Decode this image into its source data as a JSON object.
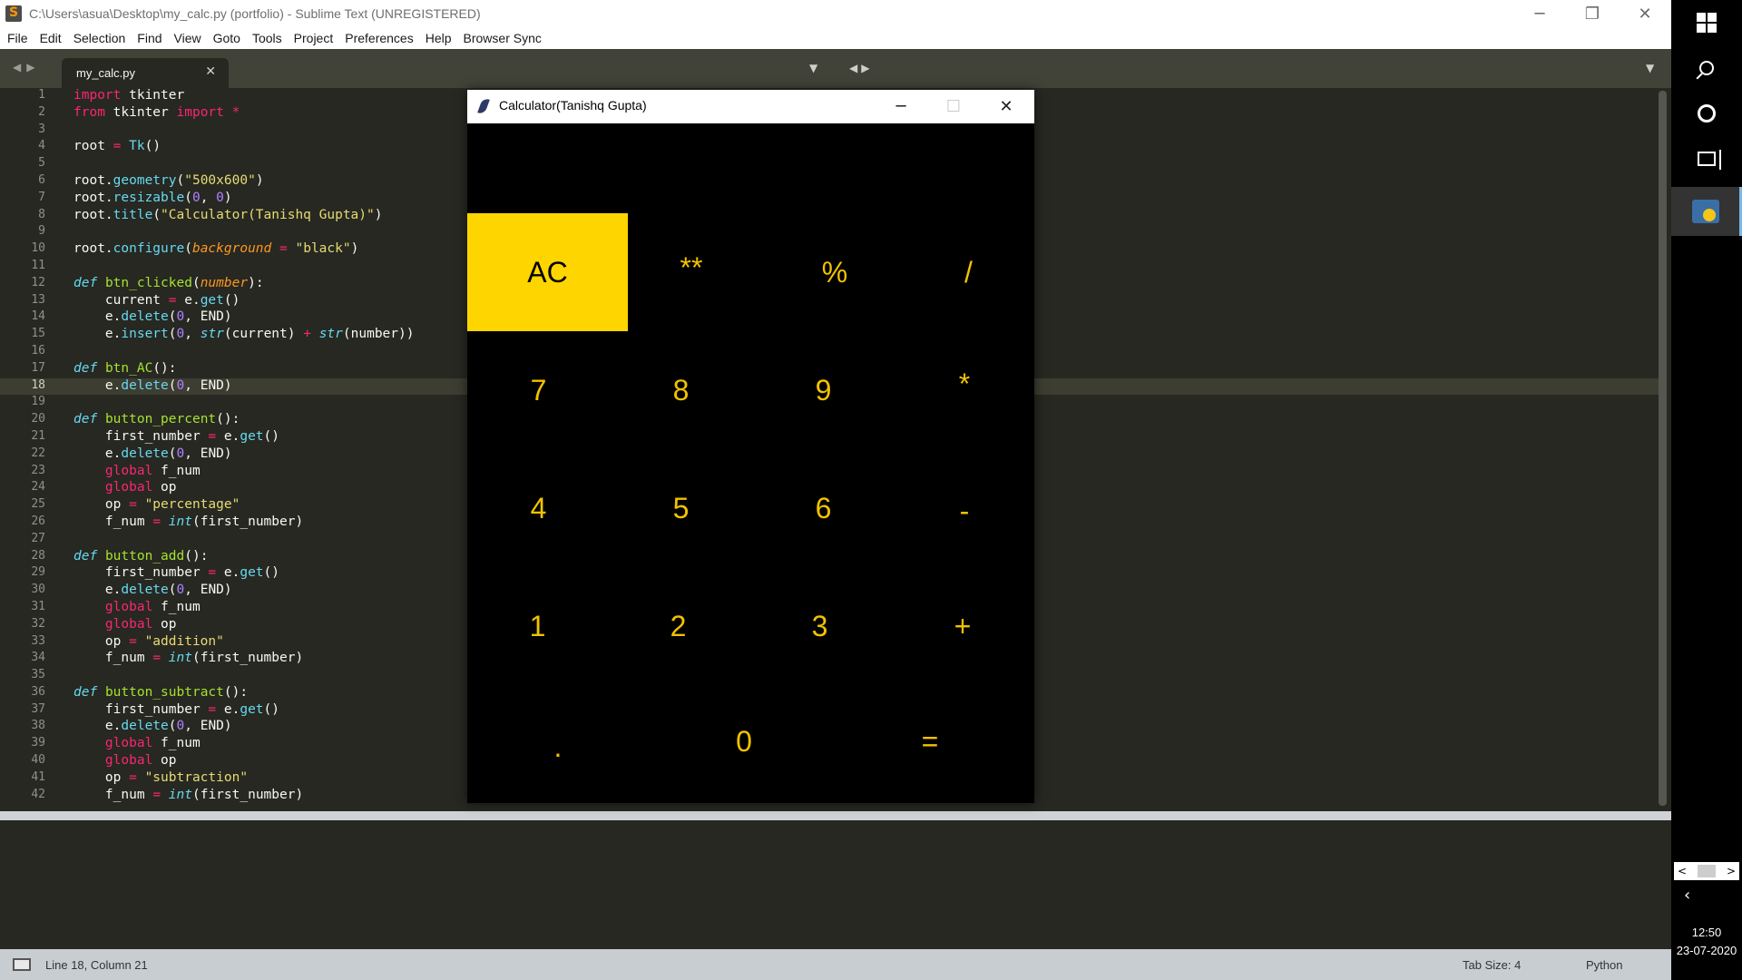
{
  "editor": {
    "title": "C:\\Users\\asua\\Desktop\\my_calc.py (portfolio) - Sublime Text (UNREGISTERED)",
    "menu": [
      "File",
      "Edit",
      "Selection",
      "Find",
      "View",
      "Goto",
      "Tools",
      "Project",
      "Preferences",
      "Help",
      "Browser Sync"
    ],
    "tab_label": "my_calc.py",
    "line_numbers": [
      "1",
      "2",
      "3",
      "4",
      "5",
      "6",
      "7",
      "8",
      "9",
      "10",
      "11",
      "12",
      "13",
      "14",
      "15",
      "16",
      "17",
      "18",
      "19",
      "20",
      "21",
      "22",
      "23",
      "24",
      "25",
      "26",
      "27",
      "28",
      "29",
      "30",
      "31",
      "32",
      "33",
      "34",
      "35",
      "36",
      "37",
      "38",
      "39",
      "40",
      "41",
      "42"
    ],
    "active_line": 18,
    "status": {
      "position": "Line 18, Column 21",
      "tab_size": "Tab Size: 4",
      "syntax": "Python"
    }
  },
  "calculator": {
    "title": "Calculator(Tanishq Gupta)",
    "buttons": {
      "ac": "AC",
      "power": "**",
      "percent": "%",
      "divide": "/",
      "seven": "7",
      "eight": "8",
      "nine": "9",
      "multiply": "*",
      "four": "4",
      "five": "5",
      "six": "6",
      "subtract": "-",
      "one": "1",
      "two": "2",
      "three": "3",
      "add": "+",
      "dot": ".",
      "zero": "0",
      "equals": "="
    },
    "accent": "#ffd500"
  },
  "taskbar": {
    "time": "12:50",
    "date": "23-07-2020"
  }
}
